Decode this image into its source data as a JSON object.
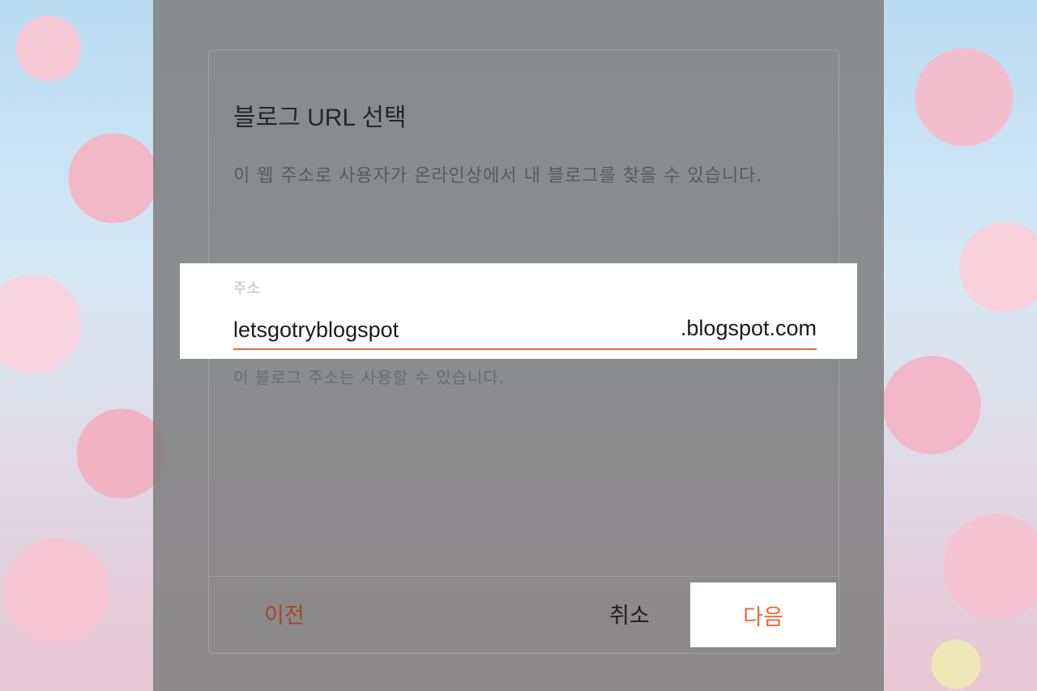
{
  "dialog": {
    "title": "블로그 URL 선택",
    "description": "이 웹 주소로 사용자가 온라인상에서 내 블로그를 찾을 수 있습니다.",
    "address_field": {
      "label": "주소",
      "value": "letsgotryblogspot",
      "suffix": ".blogspot.com"
    },
    "helper_text": "이 블로그 주소는 사용할 수 있습니다.",
    "buttons": {
      "previous": "이전",
      "cancel": "취소",
      "next": "다음"
    }
  },
  "colors": {
    "accent": "#f26a33",
    "overlay": "#808080"
  }
}
